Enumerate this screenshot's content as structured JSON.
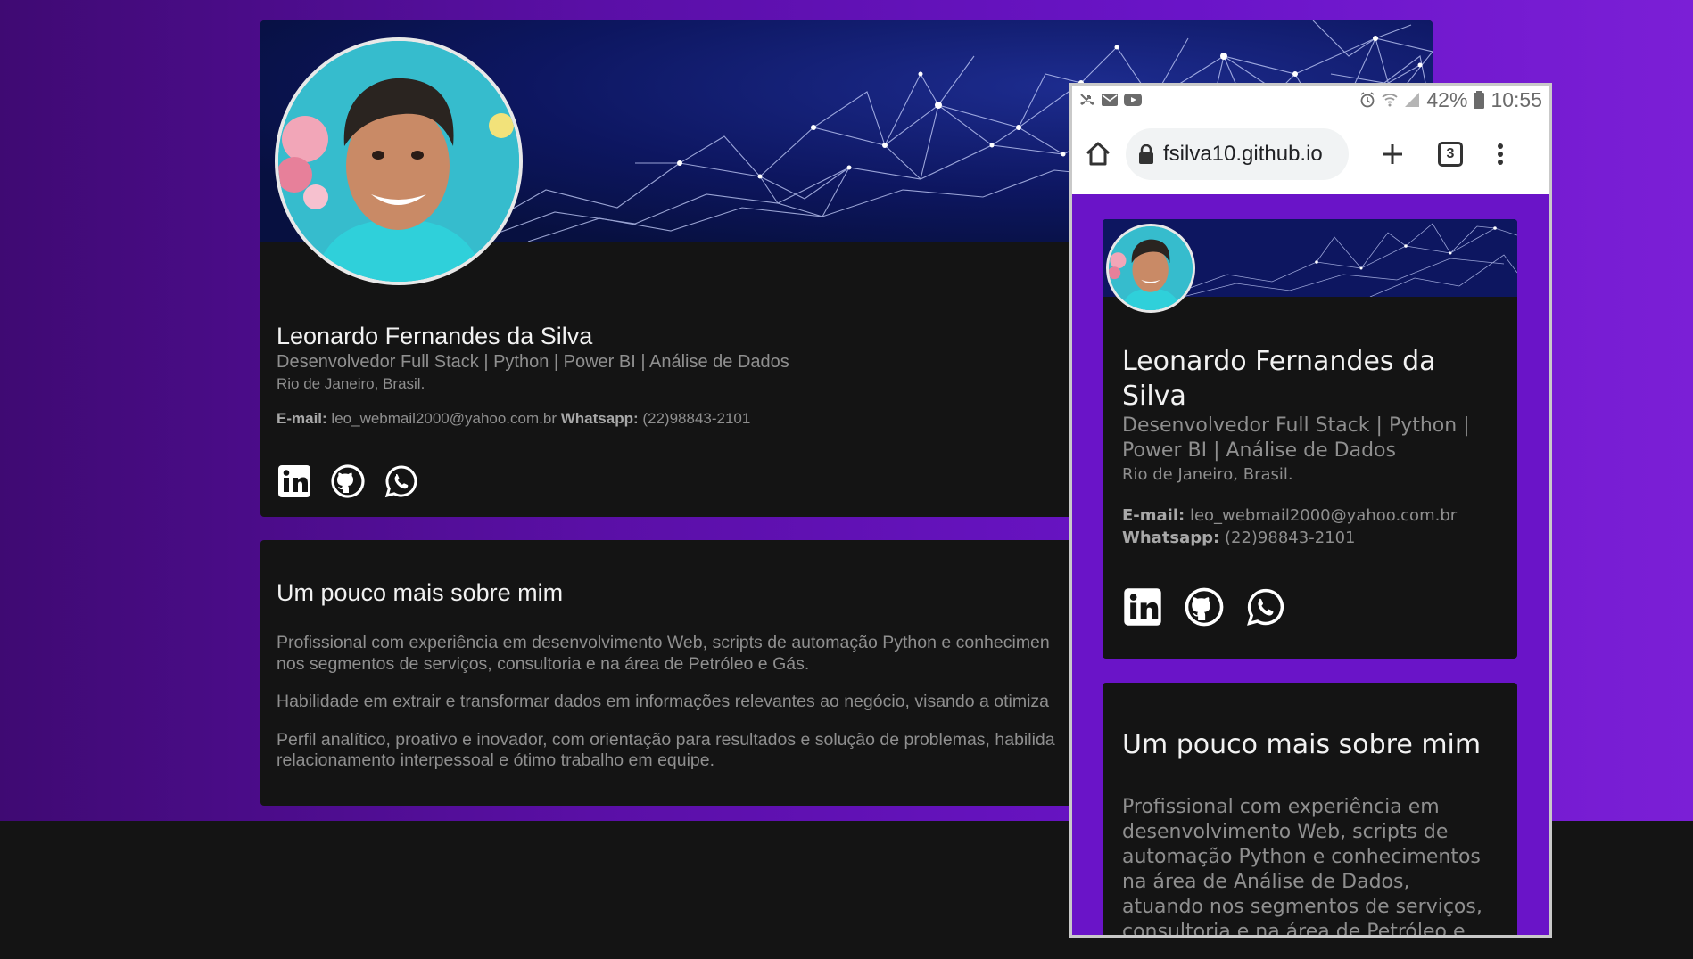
{
  "profile": {
    "name": "Leonardo Fernandes da Silva",
    "title": "Desenvolvedor Full Stack | Python | Power BI | Análise de Dados",
    "location": "Rio de Janeiro, Brasil.",
    "email_label": "E-mail:",
    "email": "leo_webmail2000@yahoo.com.br",
    "whatsapp_label": "Whatsapp:",
    "whatsapp": "(22)98843-2101",
    "social_icons": [
      "linkedin-icon",
      "github-icon",
      "whatsapp-icon"
    ]
  },
  "about": {
    "heading": "Um pouco mais sobre mim",
    "desktop_paragraphs": [
      "Profissional com experiência em desenvolvimento Web, scripts de automação Python e conhecimen",
      "nos segmentos de serviços, consultoria e na área de Petróleo e Gás.",
      "Habilidade em extrair e transformar dados em informações relevantes ao negócio, visando a otimiza",
      "Perfil analítico, proativo e inovador, com orientação para resultados e solução de problemas, habilida",
      "relacionamento interpessoal e ótimo trabalho em equipe."
    ],
    "mobile_paragraph": "Profissional com experiência em desenvolvimento Web, scripts de automação Python e conhecimentos na área de Análise de Dados, atuando nos segmentos de serviços, consultoria e na área de Petróleo e"
  },
  "phone": {
    "battery": "42%",
    "time": "10:55",
    "url": "fsilva10.github.io",
    "tab_count": "3"
  },
  "colors": {
    "background_gradient": [
      "#3f0a73",
      "#7b1fd6"
    ],
    "card": "#141414",
    "text_primary": "#f2f2f2",
    "text_secondary": "#8f8f8f"
  }
}
